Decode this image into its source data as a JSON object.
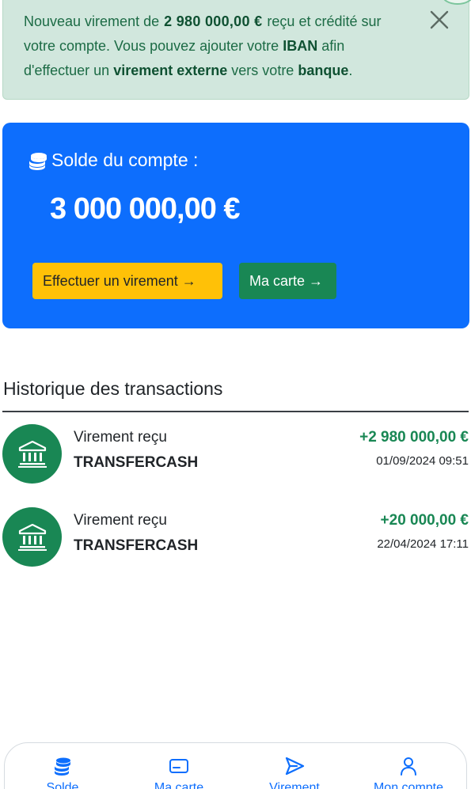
{
  "notification": {
    "text_1": "Nouveau virement de",
    "amount": "2 980 000,00 €",
    "text_2": "reçu et crédité sur votre compte. Vous pouvez ajouter votre",
    "iban": "IBAN",
    "text_3": "afin d'effectuer un",
    "external": "virement externe",
    "text_4": "vers votre",
    "bank": "banque",
    "text_5": "."
  },
  "balance": {
    "label": "Solde du compte :",
    "amount": "3 000 000,00 €",
    "transfer_button": "Effectuer un virement →",
    "card_button": "Ma carte →"
  },
  "history": {
    "title": "Historique des transactions",
    "transactions": [
      {
        "type": "Virement reçu",
        "name": "TRANSFERCASH",
        "amount": "+2 980 000,00 €",
        "date": "01/09/2024 09:51"
      },
      {
        "type": "Virement reçu",
        "name": "TRANSFERCASH",
        "amount": "+20 000,00 €",
        "date": "22/04/2024 17:11"
      }
    ]
  },
  "nav": {
    "items": [
      {
        "label": "Solde",
        "icon": "coins-icon"
      },
      {
        "label": "Ma carte",
        "icon": "card-icon"
      },
      {
        "label": "Virement",
        "icon": "send-icon"
      },
      {
        "label": "Mon compte",
        "icon": "user-icon"
      }
    ]
  },
  "colors": {
    "primary": "#0d6efd",
    "success": "#198754",
    "warning": "#ffc107",
    "notice_bg": "#d1e7dd"
  }
}
